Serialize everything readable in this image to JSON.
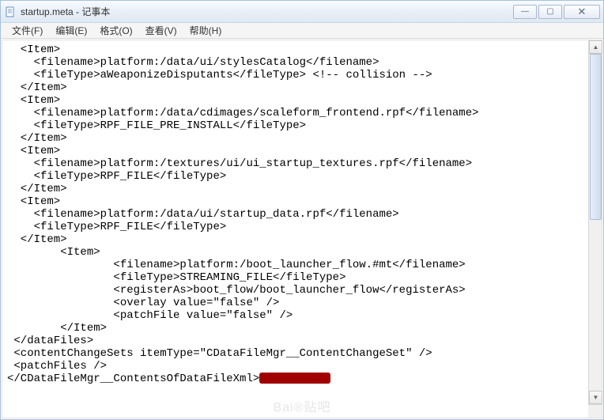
{
  "window": {
    "title": "startup.meta - 记事本",
    "min_label": "—",
    "max_label": "▢",
    "close_label": "✕"
  },
  "menu": {
    "file": "文件(F)",
    "edit": "编辑(E)",
    "format": "格式(O)",
    "view": "查看(V)",
    "help": "帮助(H)"
  },
  "doc": {
    "lines": [
      "  <Item>",
      "    <filename>platform:/data/ui/stylesCatalog</filename>",
      "    <fileType>aWeaponizeDisputants</fileType> <!-- collision -->",
      "  </Item>",
      "  <Item>",
      "    <filename>platform:/data/cdimages/scaleform_frontend.rpf</filename>",
      "    <fileType>RPF_FILE_PRE_INSTALL</fileType>",
      "  </Item>",
      "  <Item>",
      "    <filename>platform:/textures/ui/ui_startup_textures.rpf</filename>",
      "    <fileType>RPF_FILE</fileType>",
      "  </Item>",
      "  <Item>",
      "    <filename>platform:/data/ui/startup_data.rpf</filename>",
      "    <fileType>RPF_FILE</fileType>",
      "  </Item>",
      "        <Item>",
      "                <filename>platform:/boot_launcher_flow.#mt</filename>",
      "                <fileType>STREAMING_FILE</fileType>",
      "                <registerAs>boot_flow/boot_launcher_flow</registerAs>",
      "                <overlay value=\"false\" />",
      "                <patchFile value=\"false\" />",
      "        </Item>",
      " </dataFiles>",
      " <contentChangeSets itemType=\"CDataFileMgr__ContentChangeSet\" />",
      " <patchFiles />"
    ],
    "last_line_prefix": "</CDataFileMgr__ContentsOfDataFileXml>"
  },
  "watermark": "Bai®贴吧"
}
